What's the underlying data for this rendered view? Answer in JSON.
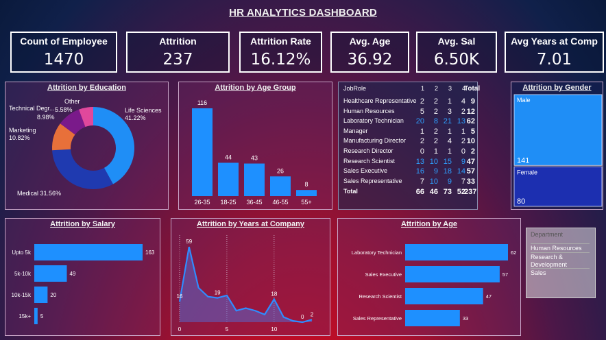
{
  "title": "HR ANALYTICS DASHBOARD",
  "kpis": [
    {
      "label": "Count of Employee",
      "value": "1470"
    },
    {
      "label": "Attrition",
      "value": "237"
    },
    {
      "label": "Attrition Rate",
      "value": "16.12%"
    },
    {
      "label": "Avg. Age",
      "value": "36.92"
    },
    {
      "label": "Avg. Sal",
      "value": "6.50K"
    },
    {
      "label": "Avg Years at Comp",
      "value": "7.01"
    }
  ],
  "panels": {
    "education": "Attrition by Education",
    "age_group": "Attrition by Age Group",
    "gender": "Attrition by Gender",
    "salary": "Attrition by Salary",
    "years": "Attrition by Years at Company",
    "age": "Attrition by Age"
  },
  "colors": {
    "bar": "#1e90ff",
    "life_sciences": "#1f8ef6",
    "medical": "#1f3ab0",
    "marketing": "#e8703a",
    "technical": "#7a1a8a",
    "other": "#e0489c",
    "gender_male": "#1f8ef6",
    "gender_female": "#1c2fb0"
  },
  "chart_data": [
    {
      "type": "pie",
      "name": "education",
      "slices": [
        {
          "label": "Life Sciences",
          "value": 41.22,
          "text": "41.22%"
        },
        {
          "label": "Medical",
          "value": 31.56,
          "text": "31.56%"
        },
        {
          "label": "Marketing",
          "value": 10.82,
          "text": "10.82%"
        },
        {
          "label": "Technical Degr...",
          "value": 8.98,
          "text": "8.98%"
        },
        {
          "label": "Other",
          "value": 5.58,
          "text": "5.58%"
        }
      ]
    },
    {
      "type": "bar",
      "name": "age_group",
      "categories": [
        "26-35",
        "18-25",
        "36-45",
        "46-55",
        "55+"
      ],
      "values": [
        116,
        44,
        43,
        26,
        8
      ]
    },
    {
      "type": "bar",
      "name": "gender",
      "categories": [
        "Male",
        "Female"
      ],
      "values": [
        141,
        80
      ]
    },
    {
      "type": "bar",
      "name": "salary",
      "categories": [
        "Upto 5k",
        "5k-10k",
        "10k-15k",
        "15k+"
      ],
      "values": [
        163,
        49,
        20,
        5
      ]
    },
    {
      "type": "area",
      "name": "years",
      "x": [
        0,
        1,
        2,
        3,
        4,
        5,
        6,
        7,
        8,
        9,
        10,
        11,
        12,
        13,
        14
      ],
      "y": [
        16,
        59,
        27,
        20,
        19,
        21,
        9,
        11,
        9,
        6,
        18,
        4,
        1,
        0,
        2
      ],
      "point_labels": {
        "0": "16",
        "1": "59",
        "4": "19",
        "10": "18",
        "13": "0",
        "14": "2"
      },
      "xticks": [
        "0",
        "5",
        "10"
      ],
      "ylim": [
        0,
        65
      ]
    },
    {
      "type": "bar",
      "name": "age",
      "categories": [
        "Laboratory Technician",
        "Sales Executive",
        "Research Scientist",
        "Sales Representative"
      ],
      "values": [
        62,
        57,
        47,
        33
      ]
    }
  ],
  "jobrole_table": {
    "headers": [
      "JobRole",
      "1",
      "2",
      "3",
      "4",
      "Total"
    ],
    "rows": [
      {
        "role": "Healthcare Representative",
        "v": [
          "2",
          "2",
          "1",
          "4"
        ],
        "total": "9"
      },
      {
        "role": "Human Resources",
        "v": [
          "5",
          "2",
          "3",
          "2"
        ],
        "total": "12"
      },
      {
        "role": "Laboratory Technician",
        "v": [
          "20",
          "8",
          "21",
          "13"
        ],
        "total": "62"
      },
      {
        "role": "Manager",
        "v": [
          "1",
          "2",
          "1",
          "1"
        ],
        "total": "5"
      },
      {
        "role": "Manufacturing Director",
        "v": [
          "2",
          "2",
          "4",
          "2"
        ],
        "total": "10"
      },
      {
        "role": "Research Director",
        "v": [
          "0",
          "1",
          "1",
          "0"
        ],
        "total": "2"
      },
      {
        "role": "Research Scientist",
        "v": [
          "13",
          "10",
          "15",
          "9"
        ],
        "total": "47"
      },
      {
        "role": "Sales Executive",
        "v": [
          "16",
          "9",
          "18",
          "14"
        ],
        "total": "57"
      },
      {
        "role": "Sales Representative",
        "v": [
          "7",
          "10",
          "9",
          "7"
        ],
        "total": "33"
      }
    ],
    "total_row": {
      "role": "Total",
      "v": [
        "66",
        "46",
        "73",
        "52"
      ],
      "total": "237"
    }
  },
  "slicer": {
    "title": "Department",
    "items": [
      "Human Resources",
      "Research & Development",
      "Sales"
    ]
  }
}
